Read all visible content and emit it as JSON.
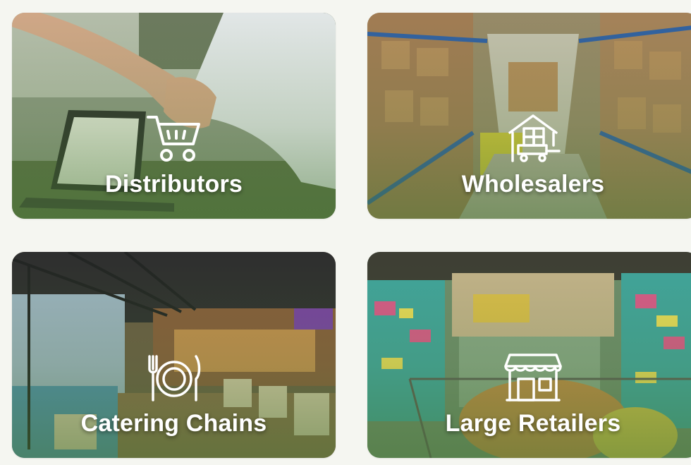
{
  "cards": [
    {
      "label": "Distributors",
      "icon": "shopping-cart-icon"
    },
    {
      "label": "Wholesalers",
      "icon": "warehouse-cart-icon"
    },
    {
      "label": "Catering Chains",
      "icon": "plate-cutlery-icon"
    },
    {
      "label": "Large Retailers",
      "icon": "storefront-icon"
    }
  ],
  "colors": {
    "page_background": "#f5f6f1",
    "overlay_tint": "#4f7d37",
    "label_text": "#ffffff"
  }
}
